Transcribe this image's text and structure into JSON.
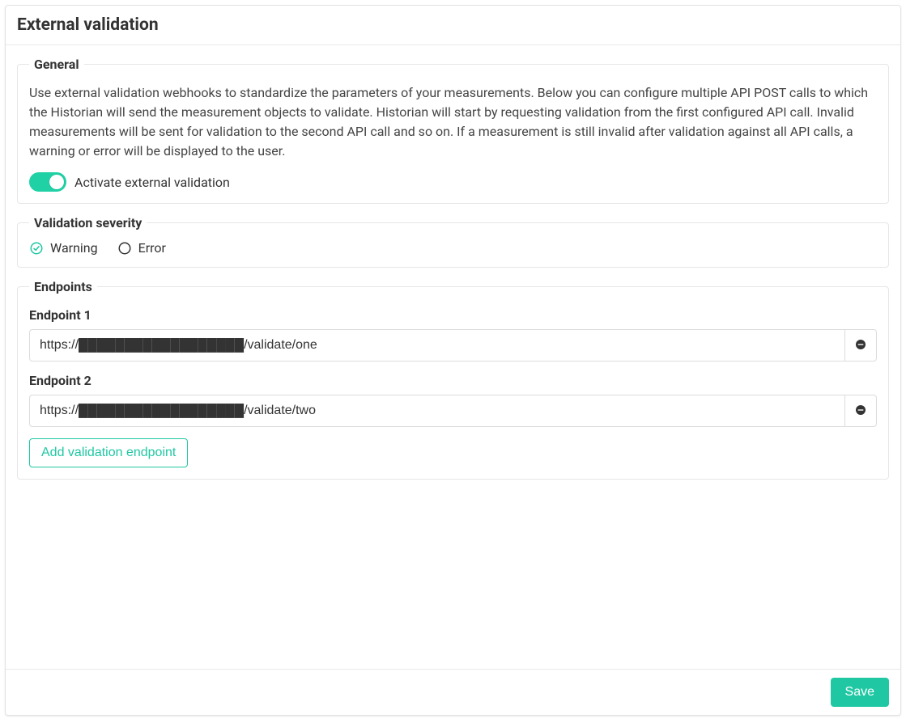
{
  "header": {
    "title": "External validation"
  },
  "general": {
    "legend": "General",
    "description": "Use external validation webhooks to standardize the parameters of your measurements. Below you can configure multiple API POST calls to which the Historian will send the measurement objects to validate. Historian will start by requesting validation from the first configured API call. Invalid measurements will be sent for validation to the second API call and so on. If a measurement is still invalid after validation against all API calls, a warning or error will be displayed to the user.",
    "toggle_label": "Activate external validation",
    "toggle_state": true
  },
  "severity": {
    "legend": "Validation severity",
    "options": {
      "warning": "Warning",
      "error": "Error"
    },
    "selected": "warning"
  },
  "endpoints": {
    "legend": "Endpoints",
    "items": [
      {
        "label": "Endpoint 1",
        "value": "https://██████████████████/validate/one"
      },
      {
        "label": "Endpoint 2",
        "value": "https://██████████████████/validate/two"
      }
    ],
    "add_label": "Add validation endpoint"
  },
  "footer": {
    "save_label": "Save"
  }
}
